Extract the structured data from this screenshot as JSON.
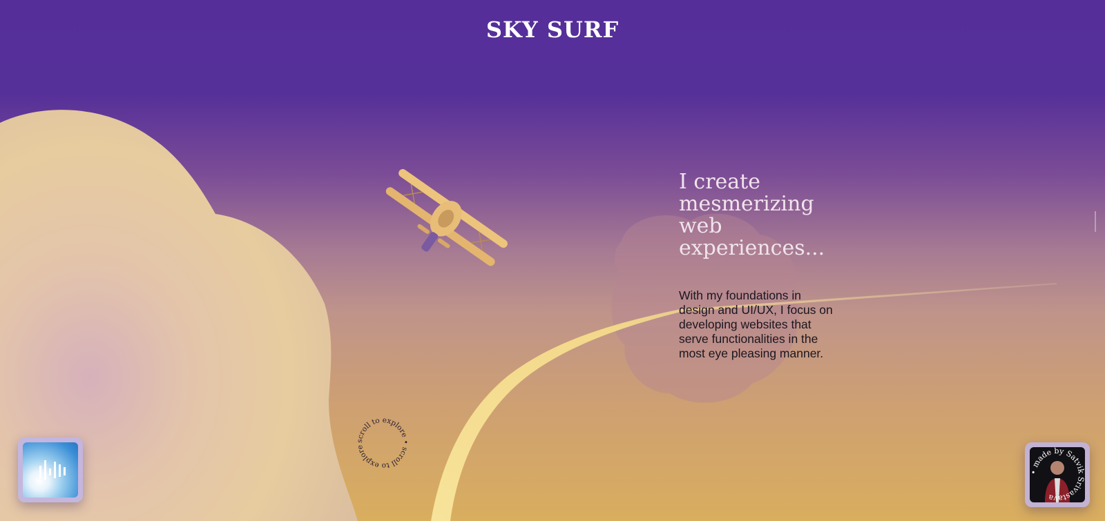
{
  "header": {
    "brand": "SKY SURF"
  },
  "hero": {
    "headline": "I create mesmerizing web experiences...",
    "body": "With my foundations in design and UI/UX, I focus on developing websites that serve functionalities in the most eye pleasing manner."
  },
  "scroll_hint": {
    "text": "scroll to explore • scroll to explore •"
  },
  "music_toggle": {
    "icon": "sound-bars-icon"
  },
  "credit": {
    "text": "• made by Satvik Srivastava "
  },
  "colors": {
    "sky_top": "#552e9a",
    "sky_bottom": "#d9ae5e",
    "cloud": "#e8c99f",
    "plane": "#edc47c",
    "trail": "#f6dc8c",
    "headline": "#f1e4ec",
    "body_text": "#1b1620"
  }
}
